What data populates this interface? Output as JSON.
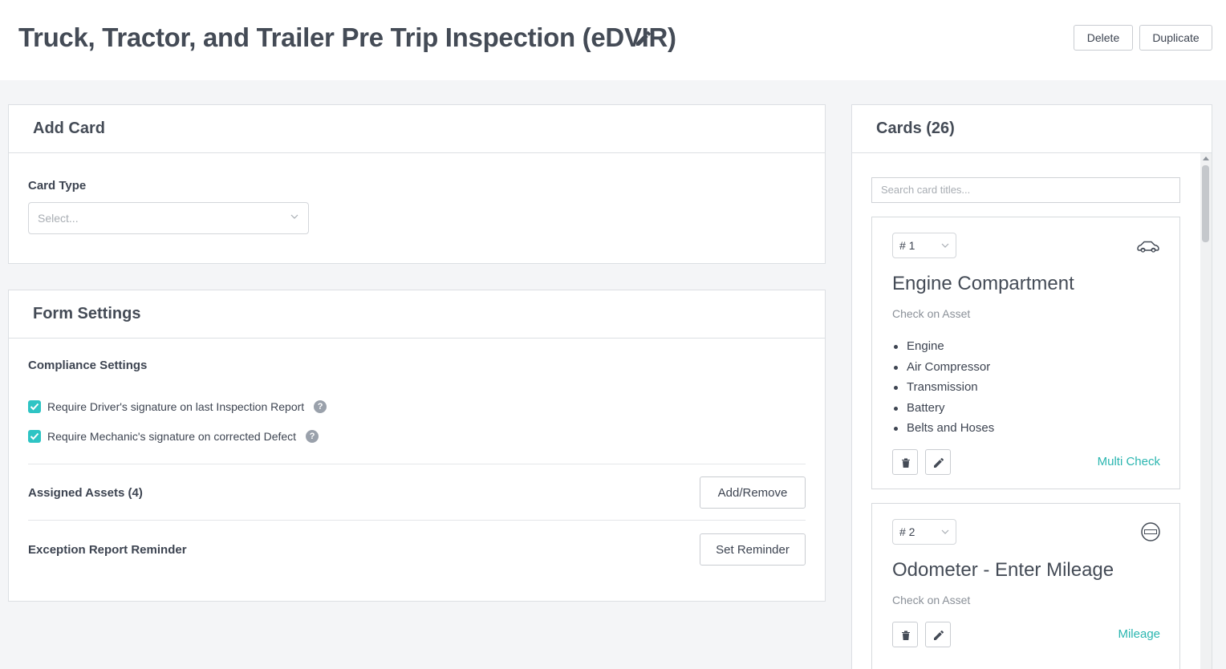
{
  "header": {
    "title": "Truck, Tractor, and Trailer Pre Trip Inspection (eDVIR)",
    "delete_label": "Delete",
    "duplicate_label": "Duplicate"
  },
  "add_card": {
    "heading": "Add Card",
    "card_type_label": "Card Type",
    "card_type_placeholder": "Select..."
  },
  "form_settings": {
    "heading": "Form Settings",
    "compliance_label": "Compliance Settings",
    "checkboxes": [
      {
        "label": "Require Driver's signature on last Inspection Report",
        "checked": true
      },
      {
        "label": "Require Mechanic's signature on corrected Defect",
        "checked": true
      }
    ],
    "help_glyph": "?",
    "assigned_assets_label": "Assigned Assets (4)",
    "add_remove_label": "Add/Remove",
    "exception_label": "Exception Report Reminder",
    "set_reminder_label": "Set Reminder"
  },
  "cards_panel": {
    "heading": "Cards (26)",
    "search_placeholder": "Search card titles...",
    "cards": [
      {
        "number": "# 1",
        "icon": "car-icon",
        "title": "Engine Compartment",
        "subtitle": "Check on Asset",
        "items": [
          "Engine",
          "Air Compressor",
          "Transmission",
          "Battery",
          "Belts and Hoses"
        ],
        "type": "Multi Check"
      },
      {
        "number": "# 2",
        "icon": "odometer-icon",
        "title": "Odometer - Enter Mileage",
        "subtitle": "Check on Asset",
        "items": [],
        "type": "Mileage"
      }
    ]
  },
  "colors": {
    "accent": "#2ec4c4",
    "card_type_text": "#2bb6b0",
    "heading_text": "#444b56",
    "background": "#f4f5f7"
  }
}
